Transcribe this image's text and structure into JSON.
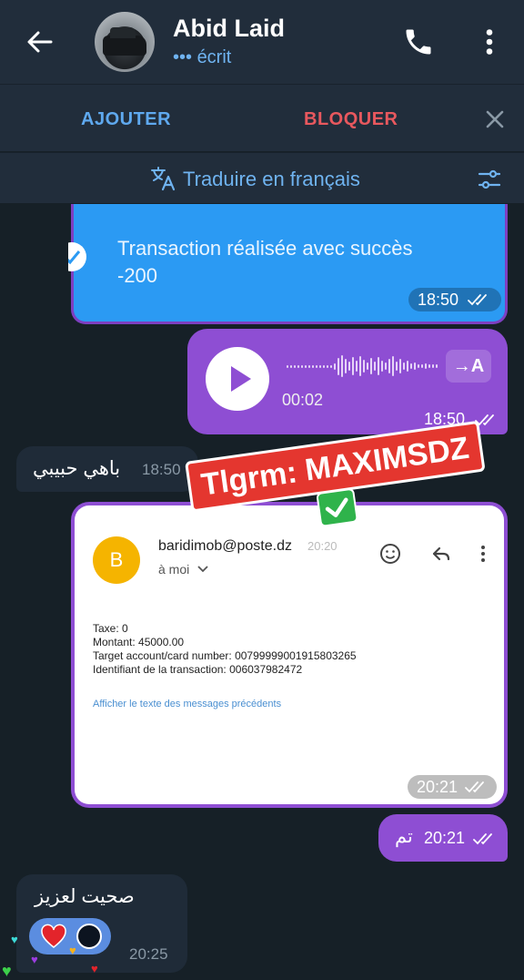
{
  "header": {
    "contact_name": "Abid Laid",
    "status_text": "••• écrit",
    "icons": [
      "back-arrow-icon",
      "phone-icon",
      "more-vertical-icon"
    ]
  },
  "action_bar": {
    "add_label": "AJOUTER",
    "block_label": "BLOQUER",
    "close_icon": "close-icon",
    "colors": {
      "add": "#5fa9ef",
      "block": "#e8585e"
    }
  },
  "translate_bar": {
    "label": "Traduire en français",
    "icons": [
      "translate-icon",
      "tune-icon"
    ]
  },
  "messages": [
    {
      "id": "m1",
      "direction": "out",
      "type": "forwarded-receipt",
      "text_line1": "Transaction réalisée avec succès",
      "text_line2": "-200",
      "time": "18:50",
      "read": true
    },
    {
      "id": "m2",
      "direction": "out",
      "type": "voice",
      "duration": "00:02",
      "transcribe_label": "→A",
      "time": "18:50",
      "read": true
    },
    {
      "id": "m3",
      "direction": "in",
      "type": "text",
      "text": "باهي حبيبي",
      "time": "18:50"
    },
    {
      "id": "m4",
      "direction": "out",
      "type": "email-screenshot",
      "time": "20:21",
      "read": true,
      "email": {
        "avatar_letter": "B",
        "sender": "baridimob@poste.dz",
        "sent_time": "20:20",
        "to": "à moi",
        "lines": [
          "Taxe: 0",
          "Montant: 45000.00",
          "Target account/card number: 00799999001915803265",
          "Identifiant de la transaction: 006037982472"
        ],
        "link_text": "Afficher le texte des messages précédents"
      }
    },
    {
      "id": "m5",
      "direction": "out",
      "type": "text",
      "text": "تم",
      "time": "20:21",
      "read": true
    },
    {
      "id": "m6",
      "direction": "in",
      "type": "text-with-stickers",
      "text": "صحيت لعزيز",
      "time": "20:25"
    }
  ],
  "overlay": {
    "promo_text": "Tlgrm: MAXIMSDZ",
    "promo_color": "#e4362f"
  },
  "colors": {
    "background": "#162027",
    "header": "#212d3b",
    "outgoing_bubble": "#8e4ed3",
    "receipt_bubble": "#2b9af3",
    "incoming_bubble": "#1f2b38"
  }
}
